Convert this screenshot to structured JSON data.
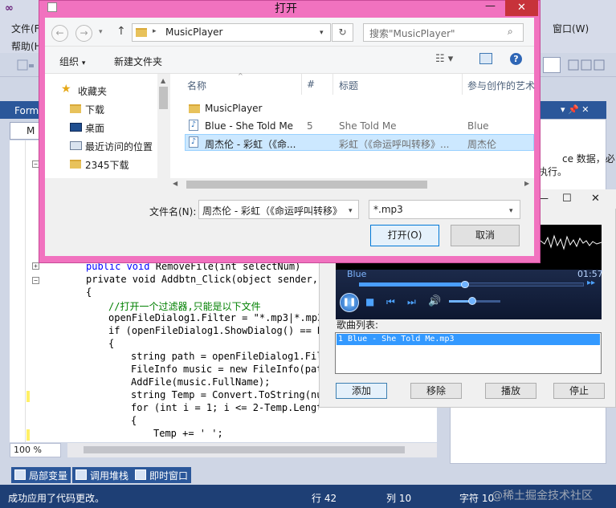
{
  "vs": {
    "menu": {
      "file": "文件(F)",
      "help": "帮助(H)",
      "window": "窗口(W)"
    },
    "tool_window_tab": "Form",
    "doc_tab": "M",
    "right_panel": {
      "text1": "ce 数据，必",
      "text2": "执行。"
    },
    "code": [
      {
        "t": "public void RemoveFile(int selectNum)"
      },
      {
        "t": "private void Addbtn_Click(object sender, E"
      },
      {
        "t": "{"
      },
      {
        "t": "//打开一个过滤器,只能是以下文件"
      },
      {
        "t": "openFileDialog1.Filter = \"*.mp3|*.mp3\""
      },
      {
        "t": "if (openFileDialog1.ShowDialog() == Di"
      },
      {
        "t": "{"
      },
      {
        "t": "string path = openFileDialog1.File"
      },
      {
        "t": "FileInfo music = new FileInfo(path"
      },
      {
        "t": "AddFile(music.FullName);"
      },
      {
        "t": "string Temp = Convert.ToString(num"
      },
      {
        "t": "for (int i = 1; i <= 2-Temp.Length; i++)"
      },
      {
        "t": "{"
      },
      {
        "t": "Temp += ' ';"
      }
    ],
    "zoom": "100 %",
    "bottom_tabs": [
      "局部变量",
      "调用堆栈",
      "即时窗口"
    ],
    "status": {
      "message": "成功应用了代码更改。",
      "line": "行 42",
      "col": "列 10",
      "char": "字符 10"
    },
    "watermark": "@稀土掘金技术社区"
  },
  "player": {
    "track_title": "Blue",
    "time": "01:57",
    "progress": 0.47,
    "volume": 0.45,
    "list_label": "歌曲列表:",
    "list_items": [
      "1 Blue - She Told Me.mp3"
    ],
    "buttons": {
      "add": "添加",
      "remove": "移除",
      "play": "播放",
      "stop": "停止"
    }
  },
  "dialog": {
    "title": "打开",
    "address": "MusicPlayer",
    "search_placeholder": "搜索\"MusicPlayer\"",
    "organize": "组织",
    "new_folder": "新建文件夹",
    "nav_items": [
      "收藏夹",
      "下载",
      "桌面",
      "最近访问的位置",
      "2345下载"
    ],
    "columns": [
      "名称",
      "#",
      "标题",
      "参与创作的艺术"
    ],
    "files": [
      {
        "name": "MusicPlayer",
        "num": "",
        "title": "",
        "artist": ""
      },
      {
        "name": "Blue - She Told Me",
        "num": "5",
        "title": "She Told Me",
        "artist": "Blue"
      },
      {
        "name": "周杰伦 - 彩虹（《命...",
        "num": "",
        "title": "彩虹（《命运呼叫转移》...",
        "artist": "周杰伦"
      }
    ],
    "filename_label": "文件名(N):",
    "filename_value": "周杰伦 - 彩虹（《命运呼叫转移》",
    "filter_value": "*.mp3",
    "open_button": "打开(O)",
    "cancel_button": "取消"
  }
}
